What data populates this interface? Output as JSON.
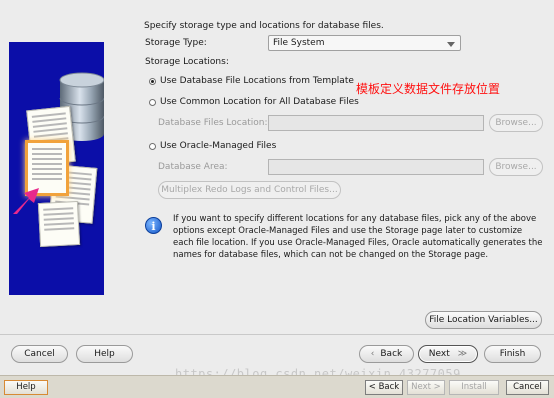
{
  "header": {
    "instruction": "Specify storage type and locations for database files."
  },
  "storage_type": {
    "label": "Storage Type:",
    "value": "File System"
  },
  "storage_locations": {
    "label": "Storage Locations:",
    "option_template": "Use Database File Locations from Template",
    "option_common": "Use Common Location for All Database Files",
    "files_location_label": "Database Files Location:",
    "option_omf": "Use Oracle-Managed Files",
    "database_area_label": "Database Area:",
    "multiplex_button": "Multiplex Redo Logs and Control Files...",
    "browse_label": "Browse..."
  },
  "annotation": "模板定义数据文件存放位置",
  "info_text": "If you want to specify different locations for any database files, pick any of the above options except Oracle-Managed Files and use the Storage page later to customize each file location. If you use Oracle-Managed Files, Oracle automatically generates the names for database files, which can not be changed on the Storage page.",
  "file_location_vars_button": "File Location Variables...",
  "footer": {
    "cancel": "Cancel",
    "help": "Help",
    "back": "Back",
    "back_icon": "‹",
    "next": "Next",
    "next_icon": "≫",
    "finish": "Finish"
  },
  "taskbar": {
    "help": "Help",
    "back": "< Back",
    "next": "Next >",
    "install": "Install",
    "cancel": "Cancel"
  },
  "watermark": "https://blog.csdn.net/weixin_43277059",
  "colors": {
    "art_bg": "#0b0ea8",
    "annotation": "#ff1010",
    "arrow": "#e8298c"
  }
}
